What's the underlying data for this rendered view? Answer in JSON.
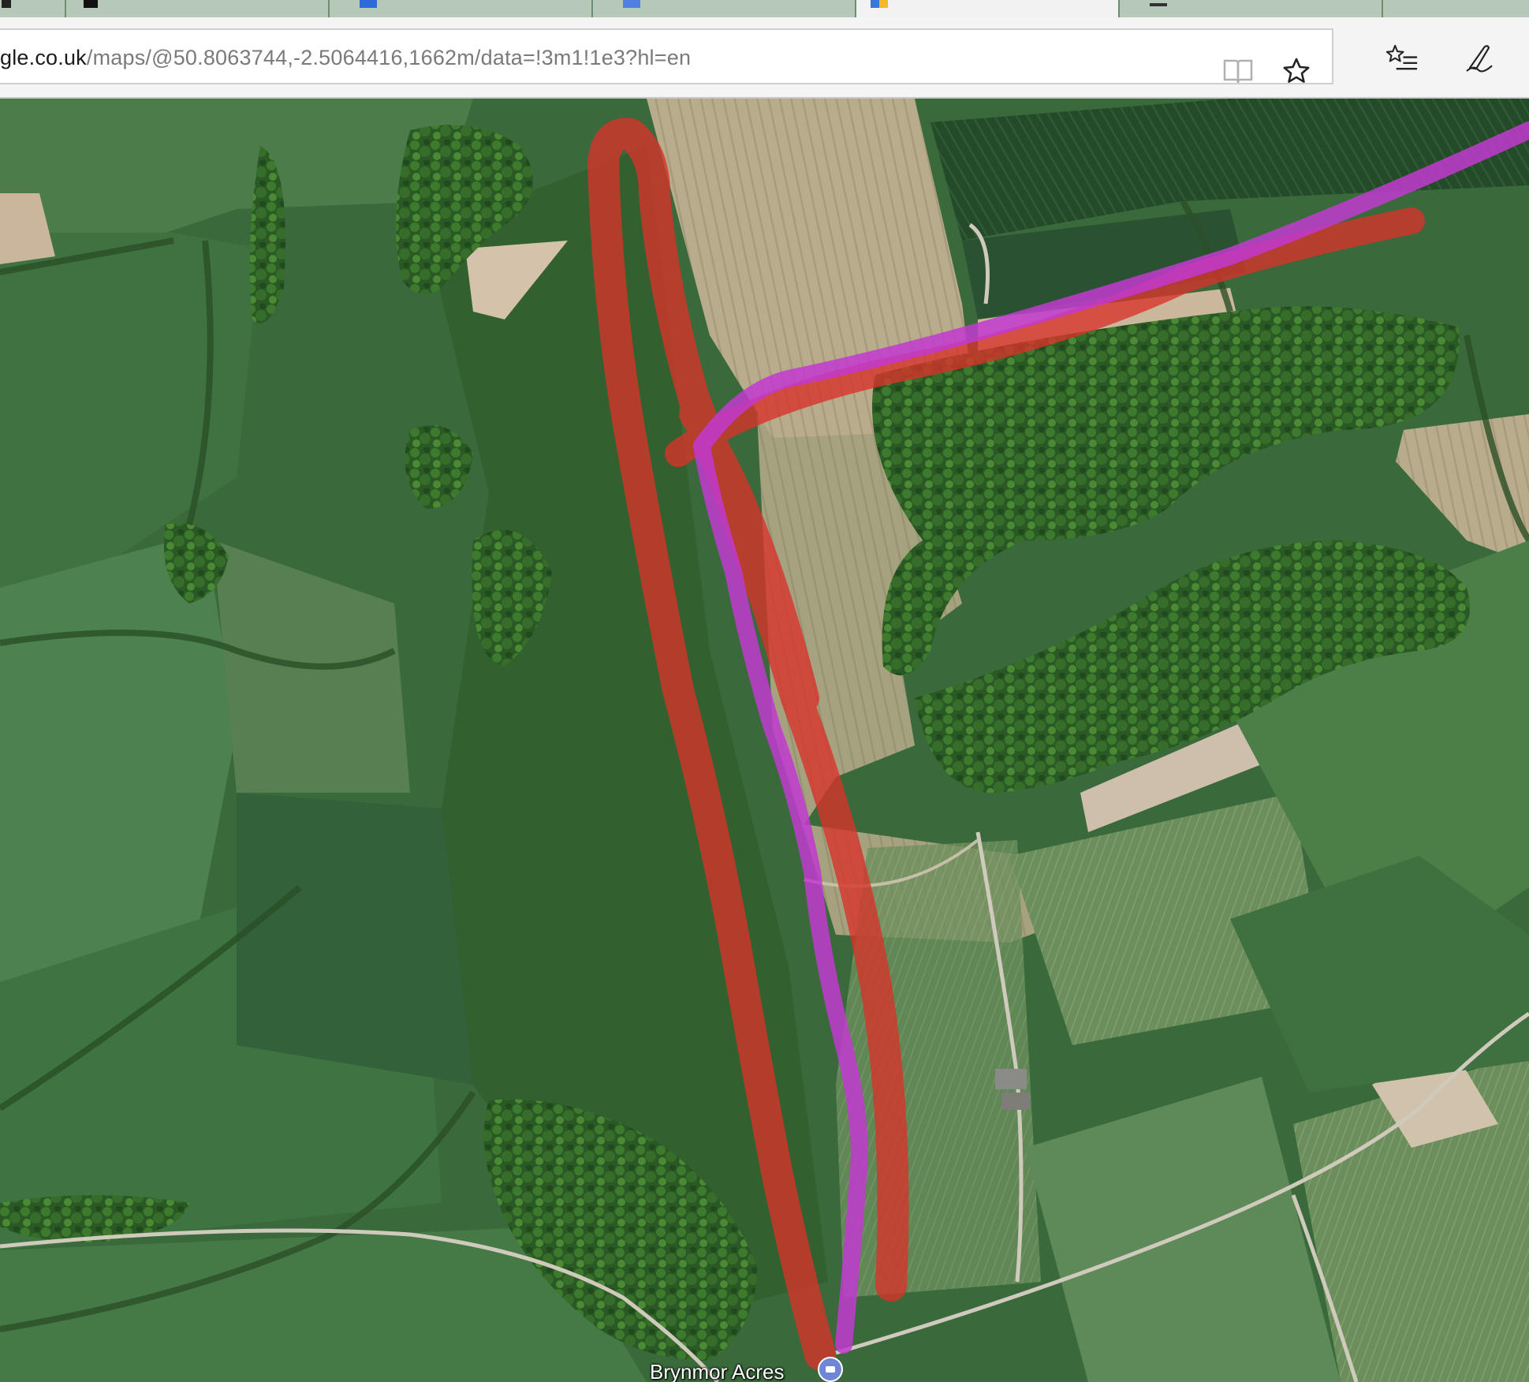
{
  "browser": {
    "tabs": [
      {
        "title": "",
        "favicon": "page-icon",
        "active": false
      },
      {
        "title": "",
        "favicon": "page-icon",
        "active": false
      },
      {
        "title": "",
        "favicon": "page-icon",
        "active": false
      },
      {
        "title": "",
        "favicon": "maps-icon",
        "active": true
      },
      {
        "title": "",
        "favicon": "page-icon",
        "active": false
      },
      {
        "title": "",
        "favicon": "page-icon",
        "active": false
      }
    ],
    "address": {
      "host": "gle.co.uk",
      "path": "/maps/@50.8063744,-2.5064416,1662m/data=!3m1!1e3?hl=en"
    },
    "toolbar_icons": [
      "reading-view-icon",
      "favorite-star-icon",
      "favorites-list-icon",
      "web-note-icon"
    ]
  },
  "map": {
    "view": "satellite",
    "place_label": "Brynmor Acres",
    "place_icon": "hotel-pin-icon",
    "route_colors": {
      "red": "#d8322a",
      "purple": "#c23ad0"
    },
    "colors": {
      "field_dark": "#2f5a31",
      "field_mid": "#3f7040",
      "field_light": "#5a8a52",
      "woodland": "#2c5a26",
      "crop_tan": "#b8a98a",
      "road": "#d8d4c8"
    }
  }
}
